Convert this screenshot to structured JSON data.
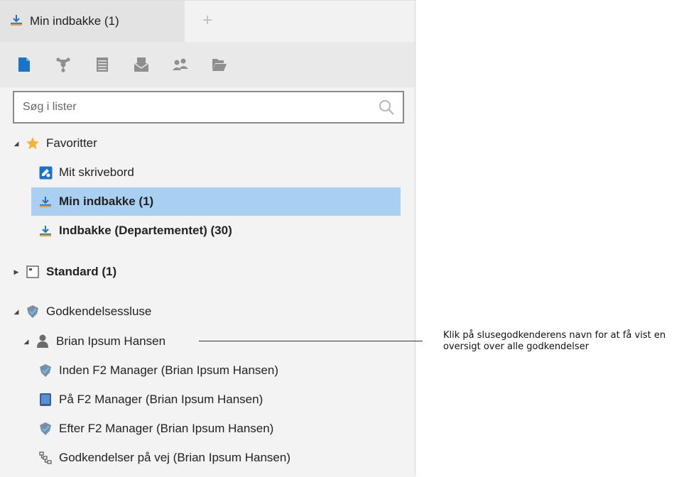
{
  "tab": {
    "label": "Min indbakke (1)",
    "add_symbol": "+"
  },
  "toolbar": {
    "buttons": [
      "document-icon",
      "network-icon",
      "list-icon",
      "mail-icon",
      "users-icon",
      "folder-open-icon"
    ]
  },
  "search": {
    "placeholder": "Søg i lister",
    "value": ""
  },
  "tree": {
    "favorites": {
      "label": "Favoritter",
      "items": [
        {
          "label": "Mit skrivebord"
        },
        {
          "label": "Min indbakke (1)",
          "selected": true
        },
        {
          "label": "Indbakke (Departementet) (30)"
        }
      ]
    },
    "standard": {
      "label": "Standard (1)"
    },
    "approval": {
      "label": "Godkendelsessluse",
      "approver": {
        "label": "Brian Ipsum Hansen",
        "items": [
          {
            "label": "Inden F2 Manager (Brian Ipsum Hansen)"
          },
          {
            "label": "På F2 Manager (Brian Ipsum Hansen)"
          },
          {
            "label": "Efter F2 Manager (Brian Ipsum Hansen)"
          },
          {
            "label": "Godkendelser på vej (Brian Ipsum Hansen)"
          }
        ]
      }
    }
  },
  "callout": {
    "text": "Klik på slusegodkenderens navn for at få vist en oversigt over alle godkendelser"
  },
  "colors": {
    "selected_bg": "#a9d0f1",
    "accent_blue": "#1a73c9",
    "inbox_orange": "#e6a23c",
    "star": "#f5b335"
  }
}
